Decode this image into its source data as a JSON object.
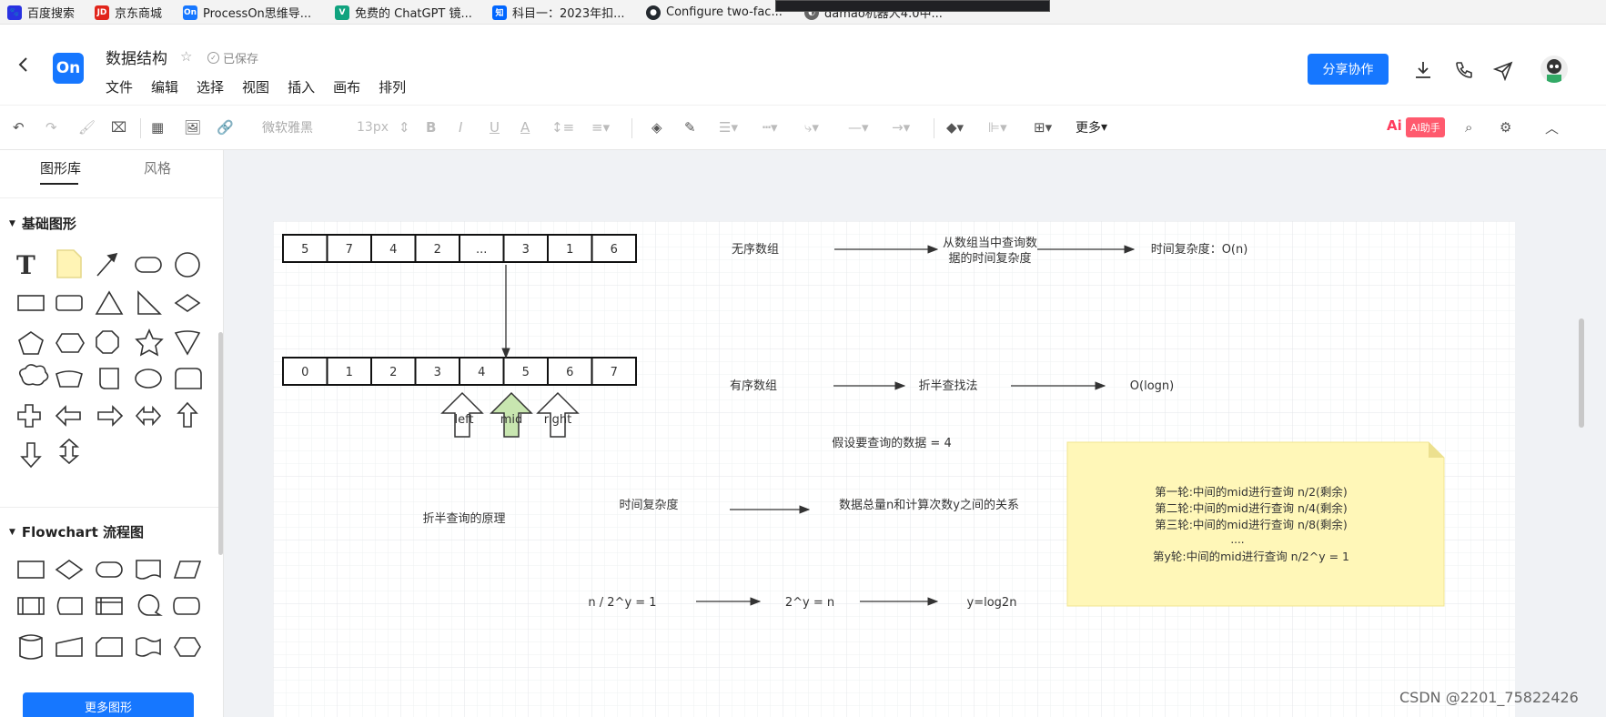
{
  "bookmarks": [
    {
      "label": "百度搜索",
      "icon": "baidu-icon",
      "color": "#2932e1"
    },
    {
      "label": "京东商城",
      "icon": "jd-icon",
      "color": "#e1251b"
    },
    {
      "label": "ProcessOn思维导...",
      "icon": "processon-icon",
      "color": "#1677ff"
    },
    {
      "label": "免费的 ChatGPT 镜...",
      "icon": "chatgpt-mirror-icon",
      "color": "#10a37f"
    },
    {
      "label": "科目一：2023年扣...",
      "icon": "zhihu-icon",
      "color": "#0066ff"
    },
    {
      "label": "Configure two-fac...",
      "icon": "github-icon",
      "color": "#24292f"
    },
    {
      "label": "damao机器人4.0中...",
      "icon": "damao-icon",
      "color": "#666666"
    }
  ],
  "header": {
    "logo_text": "On",
    "title": "数据结构",
    "saved_status": "已保存",
    "menu": [
      "文件",
      "编辑",
      "选择",
      "视图",
      "插入",
      "画布",
      "排列"
    ],
    "share_label": "分享协作"
  },
  "toolbar": {
    "font_family": "微软雅黑",
    "font_size": "13px",
    "more_label": "更多",
    "ai_mark": "Ai",
    "ai_label": "AI助手"
  },
  "left_panel": {
    "tabs": [
      "图形库",
      "风格"
    ],
    "basic_section": "基础图形",
    "flowchart_section": "Flowchart 流程图",
    "more_shapes_button": "更多图形"
  },
  "diagram": {
    "unsorted_array": [
      "5",
      "7",
      "4",
      "2",
      "...",
      "3",
      "1",
      "6"
    ],
    "sorted_array": [
      "0",
      "1",
      "2",
      "3",
      "4",
      "5",
      "6",
      "7"
    ],
    "pointer_labels": [
      "left",
      "mid",
      "right"
    ],
    "unsorted_label": "无序数组",
    "query_label_line1": "从数组当中查询数",
    "query_label_line2": "据的时间复杂度",
    "time_on": "时间复杂度：O(n)",
    "sorted_label": "有序数组",
    "binary_search_label": "折半查找法",
    "o_logn": "O(logn)",
    "assume_label": "假设要查询的数据 = 4",
    "principle_label": "折半查询的原理",
    "complexity_label": "时间复杂度",
    "relation_label": "数据总量n和计算次数y之间的关系",
    "eq1": "n / 2^y = 1",
    "eq2": "2^y = n",
    "eq3": "y=log2n",
    "note_lines": [
      "第一轮:中间的mid进行查询      n/2(剩余)",
      "第二轮:中间的mid进行查询      n/4(剩余)",
      "第三轮:中间的mid进行查询       n/8(剩余)",
      "....",
      "第y轮:中间的mid进行查询   n/2^y = 1"
    ],
    "mid_arrow_color": "#c8e6b0",
    "note_color": "#fff7b8"
  },
  "watermark": "CSDN @2201_75822426"
}
